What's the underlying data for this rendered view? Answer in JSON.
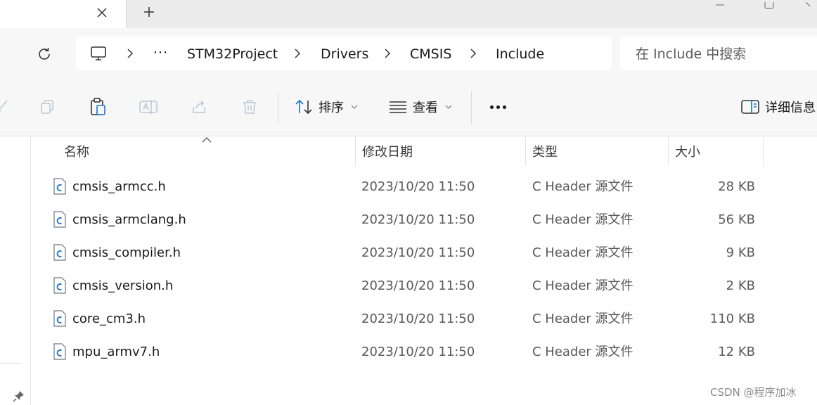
{
  "tab": {
    "close_icon": "close-icon",
    "new_tab_icon": "plus-icon"
  },
  "address": {
    "refresh_icon": "refresh-icon",
    "pc_icon": "computer-icon",
    "more_label": "···",
    "crumbs": [
      "STM32Project",
      "Drivers",
      "CMSIS",
      "Include"
    ]
  },
  "search": {
    "placeholder": "在 Include 中搜索"
  },
  "commandbar": {
    "sort_label": "排序",
    "view_label": "查看",
    "details_label": "详细信息"
  },
  "columns": {
    "name": "名称",
    "date": "修改日期",
    "type": "类型",
    "size": "大小"
  },
  "files": [
    {
      "name": "cmsis_armcc.h",
      "date": "2023/10/20 11:50",
      "type": "C Header 源文件",
      "size": "28 KB"
    },
    {
      "name": "cmsis_armclang.h",
      "date": "2023/10/20 11:50",
      "type": "C Header 源文件",
      "size": "56 KB"
    },
    {
      "name": "cmsis_compiler.h",
      "date": "2023/10/20 11:50",
      "type": "C Header 源文件",
      "size": "9 KB"
    },
    {
      "name": "cmsis_version.h",
      "date": "2023/10/20 11:50",
      "type": "C Header 源文件",
      "size": "2 KB"
    },
    {
      "name": "core_cm3.h",
      "date": "2023/10/20 11:50",
      "type": "C Header 源文件",
      "size": "110 KB"
    },
    {
      "name": "mpu_armv7.h",
      "date": "2023/10/20 11:50",
      "type": "C Header 源文件",
      "size": "12 KB"
    }
  ],
  "watermark": "CSDN @程序加冰",
  "colors": {
    "accent": "#1a73c8",
    "chrome": "#f7f7f7",
    "tabstrip": "#ececec"
  }
}
